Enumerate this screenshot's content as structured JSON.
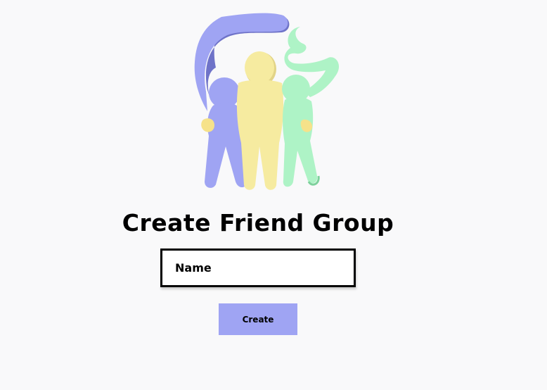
{
  "page": {
    "title": "Create Friend Group"
  },
  "form": {
    "name_placeholder": "Name",
    "name_value": "",
    "create_label": "Create"
  },
  "colors": {
    "background": "#f9f9fa",
    "purple": "#9fa4f3",
    "yellow": "#f6eba0",
    "green": "#aef3c6"
  },
  "logo": {
    "icon": "friend-group-logo-icon"
  }
}
